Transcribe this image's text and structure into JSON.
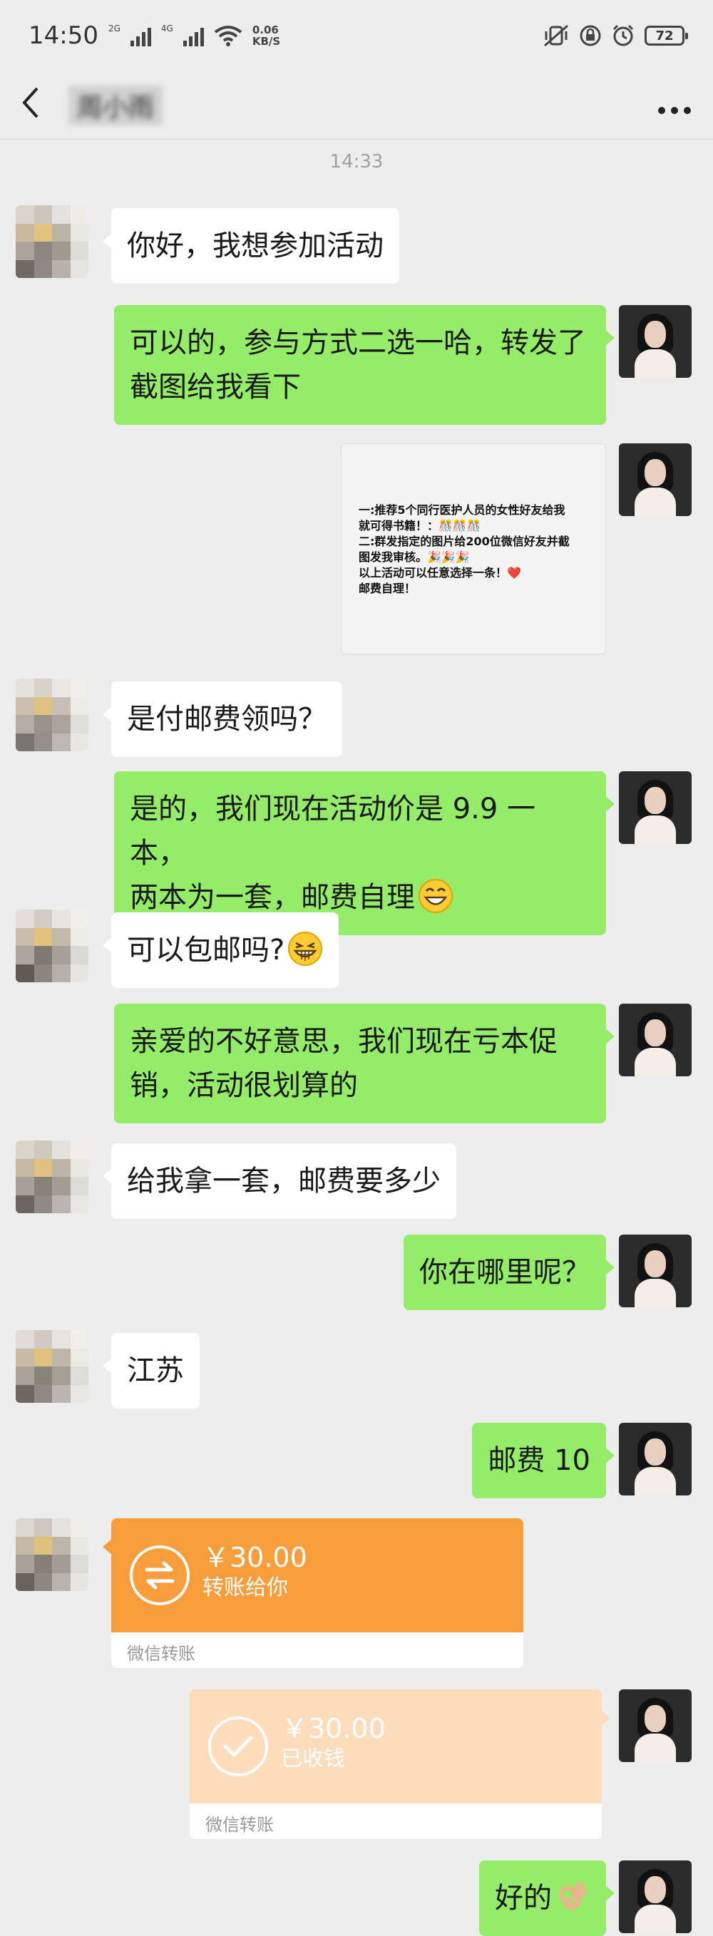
{
  "status_bar": {
    "time": "14:50",
    "network_1": "2G",
    "network_2": "4G",
    "speed_value": "0.06",
    "speed_unit": "KB/S",
    "battery": "72"
  },
  "nav": {
    "contact_name": "周小雨"
  },
  "chat": {
    "timestamp": "14:33",
    "messages": [
      {
        "side": "in",
        "text": "你好，我想参加活动"
      },
      {
        "side": "out",
        "text_line1": "可以的，参与方式二选一哈，转发了",
        "text_line2": "截图给我看下"
      },
      {
        "side": "out",
        "image_line1": "一:推荐5个同行医护人员的女性好友给我",
        "image_line2": "就可得书籍！：🎊🎊🎊",
        "image_line3": "二:群发指定的图片给200位微信好友并截",
        "image_line4": "图发我审核。🎉🎉🎉",
        "image_line5": "以上活动可以任意选择一条！❤️",
        "image_line6": "邮费自理！"
      },
      {
        "side": "in",
        "text": "是付邮费领吗？"
      },
      {
        "side": "out",
        "text_line1": "是的，我们现在活动价是 9.9 一本，",
        "text_line2": "两本为一套，邮费自理"
      },
      {
        "side": "in",
        "text": "可以包邮吗?"
      },
      {
        "side": "out",
        "text_line1": "亲爱的不好意思，我们现在亏本促",
        "text_line2": "销，活动很划算的"
      },
      {
        "side": "in",
        "text": "给我拿一套，邮费要多少"
      },
      {
        "side": "out",
        "text": "你在哪里呢？"
      },
      {
        "side": "in",
        "text": "江苏"
      },
      {
        "side": "out",
        "text": "邮费 10"
      },
      {
        "side": "in",
        "amount": "￥30.00",
        "status": "转账给你",
        "label": "微信转账"
      },
      {
        "side": "out",
        "amount": "￥30.00",
        "status": "已收钱",
        "label": "微信转账"
      },
      {
        "side": "out",
        "text": "好的"
      }
    ]
  },
  "colors": {
    "background": "#ededed",
    "out_bubble": "#95ec69",
    "in_bubble": "#ffffff",
    "transfer_pending": "#f89d3b",
    "transfer_received": "#fcdcbb"
  },
  "icons": {
    "back": "chevron-left-icon",
    "more": "more-dots-icon",
    "wifi": "wifi-icon",
    "transfer": "transfer-arrows-icon",
    "received": "check-circle-icon"
  }
}
